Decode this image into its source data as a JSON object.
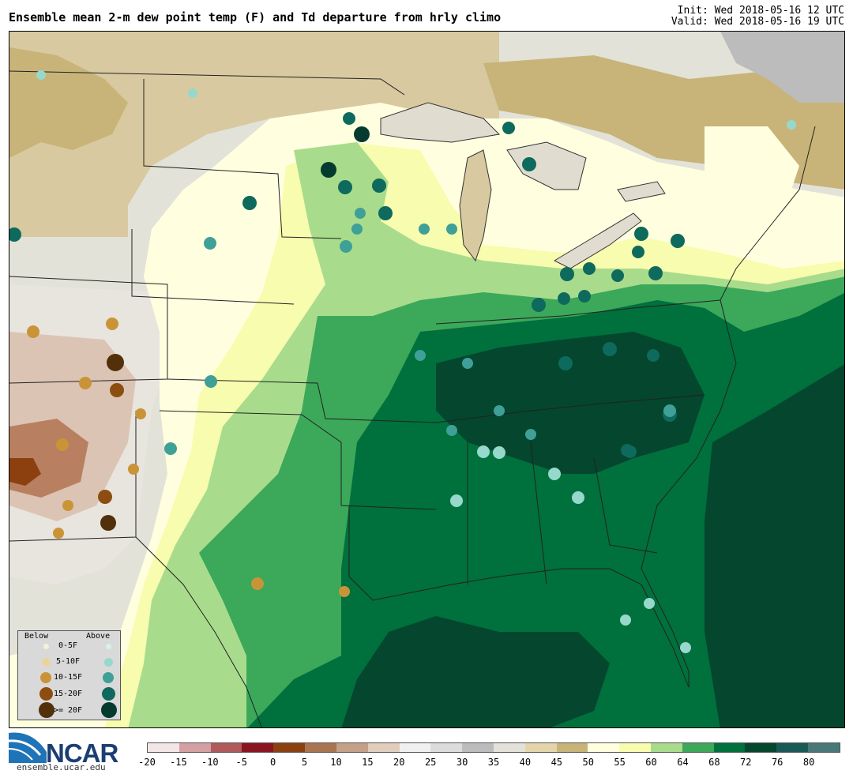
{
  "header": {
    "title": "Ensemble mean 2-m dew point temp (F) and Td departure from hrly climo",
    "init": "Init: Wed 2018-05-16 12 UTC",
    "valid": "Valid: Wed 2018-05-16 19 UTC"
  },
  "legend": {
    "below_label": "Below",
    "above_label": "Above",
    "rows": [
      {
        "label": "0-5F",
        "below_color": "#f5f0d8",
        "above_color": "#d6f2ee"
      },
      {
        "label": "5-10F",
        "below_color": "#ead3a0",
        "above_color": "#96d9cc"
      },
      {
        "label": "10-15F",
        "below_color": "#c99438",
        "above_color": "#3fa097"
      },
      {
        "label": "15-20F",
        "below_color": "#8c4e10",
        "above_color": "#0e6a5c"
      },
      {
        "label": ">= 20F",
        "below_color": "#52300a",
        "above_color": "#053b2f"
      }
    ]
  },
  "colorbar": {
    "colors": [
      "#f3e6e6",
      "#d4a0a2",
      "#b05a5c",
      "#8a1520",
      "#8c4010",
      "#a87550",
      "#c4a088",
      "#e0cdbc",
      "#f0f0f0",
      "#dcdcdc",
      "#bcbcbc",
      "#e2e2d8",
      "#e4d4aa",
      "#c8b478",
      "#ffffe0",
      "#f8fcae",
      "#a8dc8c",
      "#3ca85a",
      "#00703c",
      "#04462e",
      "#1a5a56",
      "#4a7878"
    ],
    "ticks": [
      "-20",
      "-15",
      "-10",
      "-5",
      "0",
      "5",
      "10",
      "15",
      "20",
      "25",
      "30",
      "35",
      "40",
      "45",
      "50",
      "55",
      "60",
      "64",
      "68",
      "72",
      "76",
      "80"
    ]
  },
  "logo": {
    "brand": "NCAR",
    "url": "ensemble.ucar.edu"
  },
  "map": {
    "fill_colors": {
      "dry_tan": "#d9c9a0",
      "dark_tan": "#c8b478",
      "gray_dry": "#e2e2d8",
      "brown_dry": "#b88060",
      "pale_yellow": "#ffffe0",
      "yellow": "#f8fcae",
      "light_green": "#a8dc8c",
      "mid_green": "#3ca85a",
      "green": "#00703c",
      "dark_green": "#04462e"
    }
  }
}
